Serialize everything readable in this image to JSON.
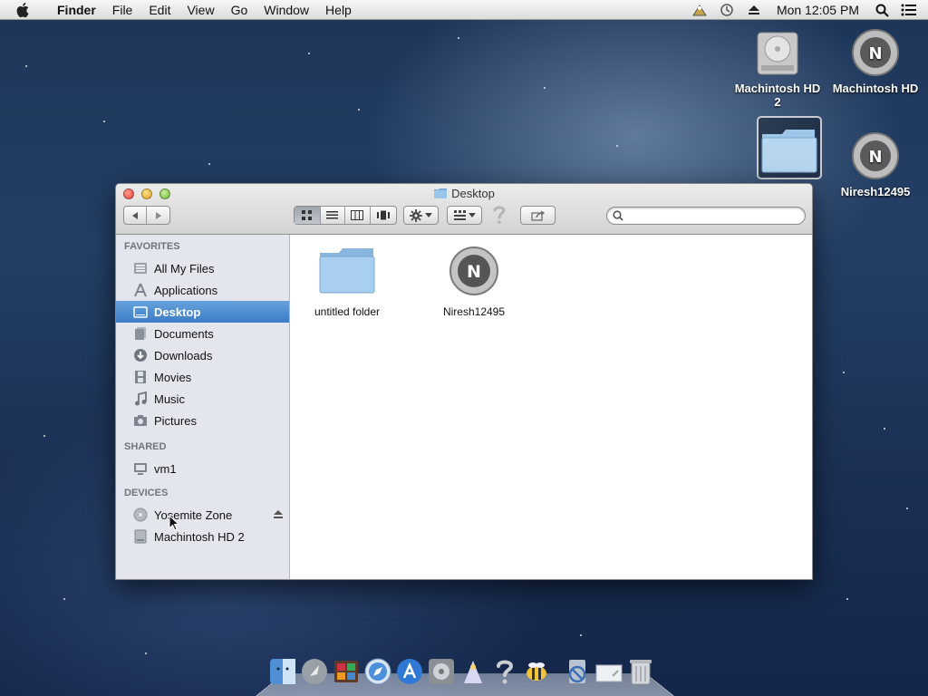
{
  "menubar": {
    "app_name": "Finder",
    "menus": [
      "File",
      "Edit",
      "View",
      "Go",
      "Window",
      "Help"
    ],
    "clock": "Mon 12:05 PM"
  },
  "desktop_icons": [
    {
      "label": "Machintosh HD 2",
      "icon": "hard-drive-icon"
    },
    {
      "label": "Machintosh HD",
      "icon": "niresh-disk-icon"
    },
    {
      "label": "Niresh12495",
      "icon": "niresh-disk-icon"
    }
  ],
  "window": {
    "title": "Desktop",
    "search_placeholder": ""
  },
  "sidebar": {
    "sections": [
      {
        "title": "FAVORITES",
        "items": [
          {
            "label": "All My Files",
            "icon": "all-files-icon"
          },
          {
            "label": "Applications",
            "icon": "applications-icon"
          },
          {
            "label": "Desktop",
            "icon": "desktop-icon",
            "selected": true
          },
          {
            "label": "Documents",
            "icon": "documents-icon"
          },
          {
            "label": "Downloads",
            "icon": "downloads-icon"
          },
          {
            "label": "Movies",
            "icon": "movies-icon"
          },
          {
            "label": "Music",
            "icon": "music-icon"
          },
          {
            "label": "Pictures",
            "icon": "pictures-icon"
          }
        ]
      },
      {
        "title": "SHARED",
        "items": [
          {
            "label": "vm1",
            "icon": "computer-icon"
          }
        ]
      },
      {
        "title": "DEVICES",
        "items": [
          {
            "label": "Yosemite Zone",
            "icon": "optical-disc-icon"
          },
          {
            "label": "Machintosh HD 2",
            "icon": "hard-drive-icon"
          }
        ]
      }
    ]
  },
  "content_items": [
    {
      "label": "untitled folder",
      "icon": "folder-icon"
    },
    {
      "label": "Niresh12495",
      "icon": "niresh-disk-icon"
    }
  ],
  "colors": {
    "selection": "#3b7dc6",
    "sidebar_bg": "#e3e7ed"
  }
}
